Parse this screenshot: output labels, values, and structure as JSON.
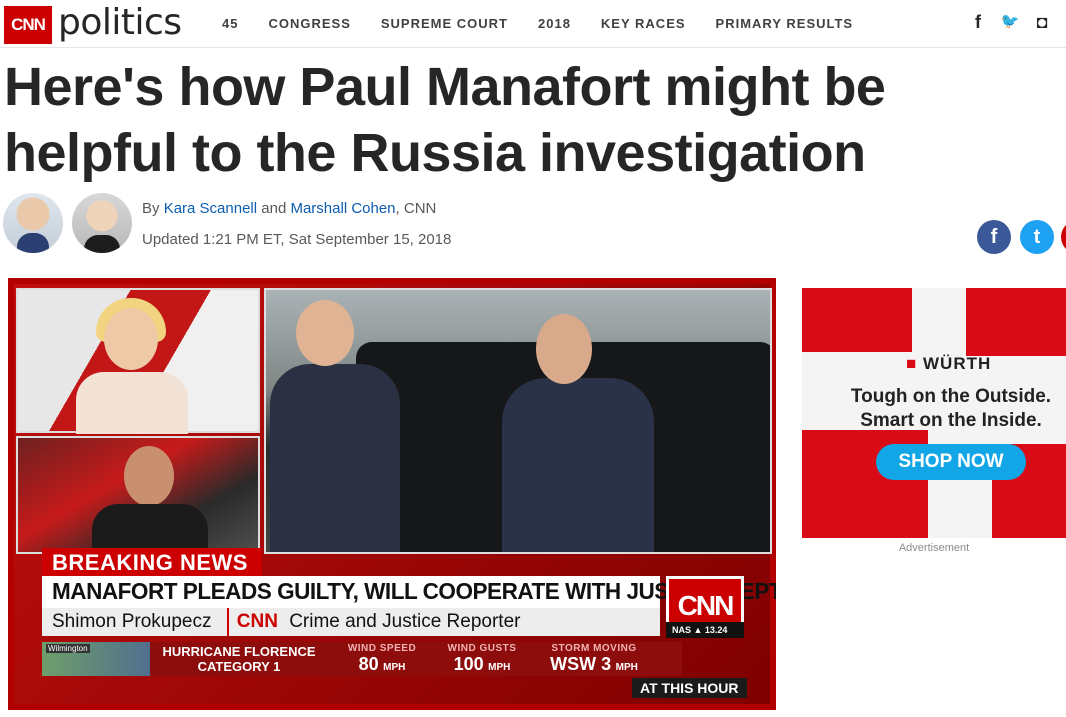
{
  "header": {
    "logo_text": "CNN",
    "section": "politics",
    "nav": [
      "45",
      "CONGRESS",
      "SUPREME COURT",
      "2018",
      "KEY RACES",
      "PRIMARY RESULTS"
    ],
    "social": [
      {
        "icon": "facebook-icon",
        "glyph": "f"
      },
      {
        "icon": "twitter-icon",
        "glyph": "🐦"
      },
      {
        "icon": "instagram-icon",
        "glyph": "◘"
      }
    ]
  },
  "article": {
    "headline": "Here's how Paul Manafort might be helpful to the Russia investigation",
    "by_prefix": "By",
    "author1": "Kara Scannell",
    "and": "and",
    "author2": "Marshall Cohen",
    "source": ", CNN",
    "updated": "Updated 1:21 PM ET, Sat September 15, 2018",
    "share": {
      "facebook": "f",
      "twitter": "t",
      "more": ""
    }
  },
  "video": {
    "breaking": "BREAKING NEWS",
    "banner": "MANAFORT PLEADS GUILTY, WILL COOPERATE WITH JUSTICE DEPT",
    "reporter": "Shimon Prokupecz",
    "network_mini": "CNN",
    "reporter_title": "Crime and Justice Reporter",
    "bug": "CNN",
    "nas_label": "NAS ▲ 13.24",
    "map_label": "Wilmington",
    "storm_name": "HURRICANE FLORENCE",
    "storm_category": "CATEGORY 1",
    "stats": [
      {
        "label": "WIND SPEED",
        "value": "80",
        "unit": "MPH"
      },
      {
        "label": "WIND GUSTS",
        "value": "100",
        "unit": "MPH"
      },
      {
        "label": "STORM MOVING",
        "value": "WSW 3",
        "unit": "MPH"
      }
    ],
    "at_this_hour": "AT THIS HOUR"
  },
  "ad": {
    "brand": "WÜRTH",
    "line1": "Tough on the Outside.",
    "line2": "Smart on the Inside.",
    "cta": "SHOP NOW",
    "label": "Advertisement"
  }
}
